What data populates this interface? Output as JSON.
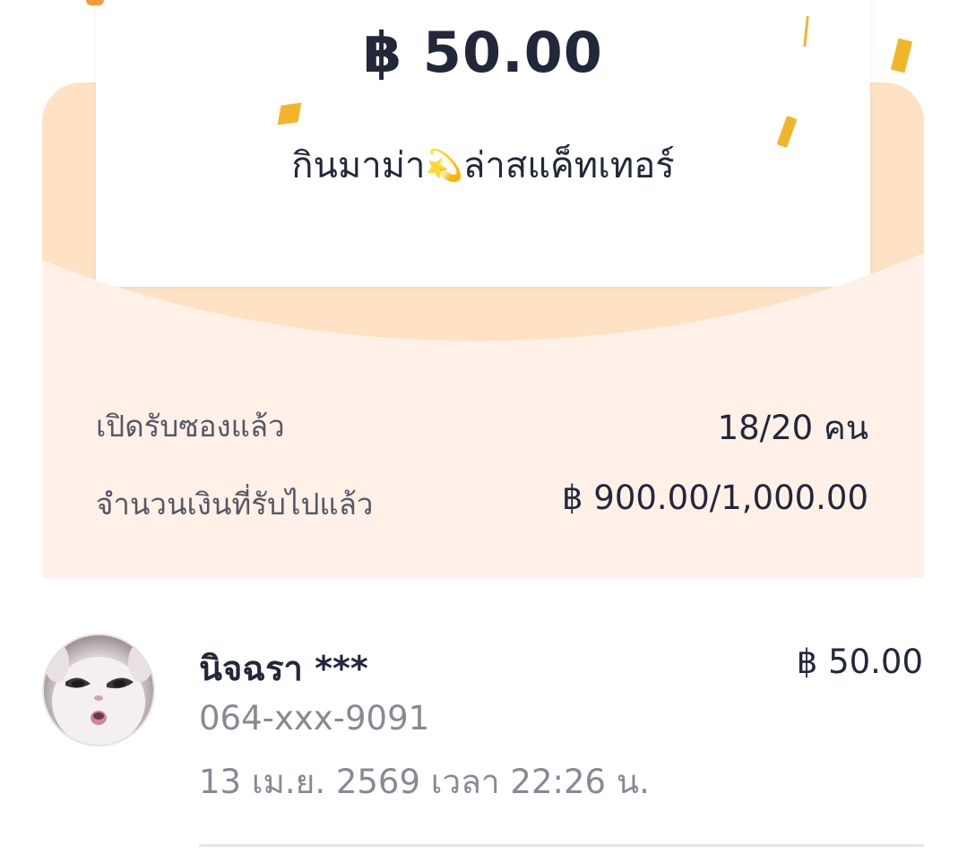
{
  "red_packet": {
    "amount": "฿ 50.00",
    "message_before": "กินมาม่า",
    "sparkle_icon": "dizzy-star-icon",
    "message_after": "ล่าสแค็ทเทอร์"
  },
  "stats": {
    "opened_label": "เปิดรับซองแล้ว",
    "opened_value": "18/20 คน",
    "received_label": "จำนวนเงินที่รับไปแล้ว",
    "received_value": "฿ 900.00/1,000.00"
  },
  "recipients": [
    {
      "name": "นิจฉรา ***",
      "amount": "฿ 50.00",
      "phone": "064-xxx-9091",
      "time": "13 เม.ย. 2569 เวลา 22:26 น."
    }
  ],
  "colors": {
    "envelope_back": "#ffe1c4",
    "envelope_front": "#fff1e7",
    "text_primary": "#22283a",
    "text_secondary": "#868a94",
    "confetti": "#f2b52a"
  }
}
